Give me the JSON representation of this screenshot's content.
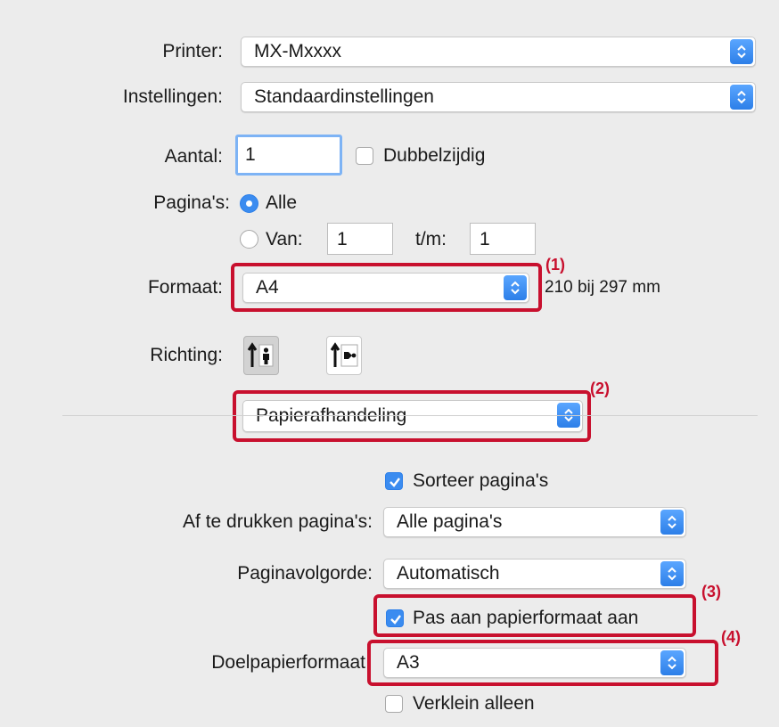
{
  "printer": {
    "label": "Printer:",
    "value": "MX-Mxxxx"
  },
  "settings": {
    "label": "Instellingen:",
    "value": "Standaardinstellingen"
  },
  "copies": {
    "label": "Aantal:",
    "value": "1",
    "duplex_label": "Dubbelzijdig",
    "duplex_checked": false
  },
  "pages": {
    "label": "Pagina's:",
    "all_label": "Alle",
    "all_selected": true,
    "from_label": "Van:",
    "from_value": "1",
    "to_label": "t/m:",
    "to_value": "1"
  },
  "paper_size": {
    "label": "Formaat:",
    "value": "A4",
    "dimensions": "210 bij 297 mm"
  },
  "orientation": {
    "label": "Richting:",
    "options": [
      "portrait-icon",
      "landscape-icon"
    ],
    "selected": "portrait-icon"
  },
  "section": {
    "value": "Papierafhandeling"
  },
  "collate": {
    "label": "Sorteer pagina's",
    "checked": true
  },
  "pages_to_print": {
    "label": "Af te drukken pagina's:",
    "value": "Alle pagina's"
  },
  "page_order": {
    "label": "Paginavolgorde:",
    "value": "Automatisch"
  },
  "scale_to_fit": {
    "label": "Pas aan papierformaat aan",
    "checked": true
  },
  "destination_paper": {
    "label": "Doelpapierformaat",
    "value": "A3"
  },
  "scale_down_only": {
    "label": "Verklein alleen",
    "checked": false
  },
  "callouts": {
    "c1": "(1)",
    "c2": "(2)",
    "c3": "(3)",
    "c4": "(4)"
  },
  "colors": {
    "accent": "#3b8cf0",
    "highlight": "#c8102e",
    "background": "#ececec"
  }
}
